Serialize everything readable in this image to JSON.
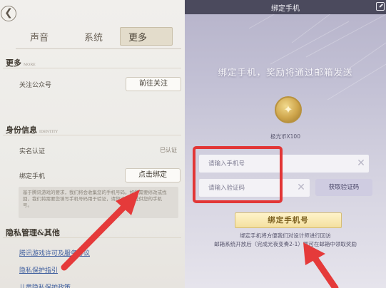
{
  "settings": {
    "back_glyph": "❮",
    "tabs": [
      {
        "label": "声音",
        "active": false
      },
      {
        "label": "系统",
        "active": false
      },
      {
        "label": "更多",
        "active": true
      }
    ],
    "more": {
      "title": "更多",
      "subtitle": "MORE",
      "follow_label": "关注公众号",
      "follow_button": "前往关注"
    },
    "identity": {
      "title": "身份信息",
      "subtitle": "IDENTITY",
      "realname_label": "实名认证",
      "realname_status": "已认证",
      "bind_label": "绑定手机",
      "bind_button": "点击绑定",
      "note": "基于腾讯游戏的要求，我们将会收集您的手机号码。如您需要修改或找回，我们将需要您填写手机号码用于验证，请您谅解并提供您的手机号。"
    },
    "privacy": {
      "title": "隐私管理&其他",
      "links": [
        "腾讯游戏许可及服务协议",
        "隐私保护指引",
        "儿童隐私保护政策"
      ]
    }
  },
  "bind_dialog": {
    "title": "绑定手机",
    "heading": "绑定手机，奖励将通过邮箱发送",
    "reward_label": "极光币X100",
    "phone_placeholder": "请输入手机号",
    "code_placeholder": "请输入验证码",
    "get_code_button": "获取验证码",
    "bind_button": "绑定手机号",
    "footer_line1": "绑定手机将方便我们对设计师进行回访",
    "footer_line2": "邮箱系统开放后（完成光夜变奏2-1）即可在邮箱中领取奖励"
  },
  "colors": {
    "highlight_box": "#e23636",
    "arrow": "#e53a3a",
    "header_bg": "#4b4a5d",
    "gold": "#cfa64c"
  },
  "icons": {
    "header_corner": "minimize-icon",
    "clear": "close-icon",
    "coin": "coin-icon"
  }
}
